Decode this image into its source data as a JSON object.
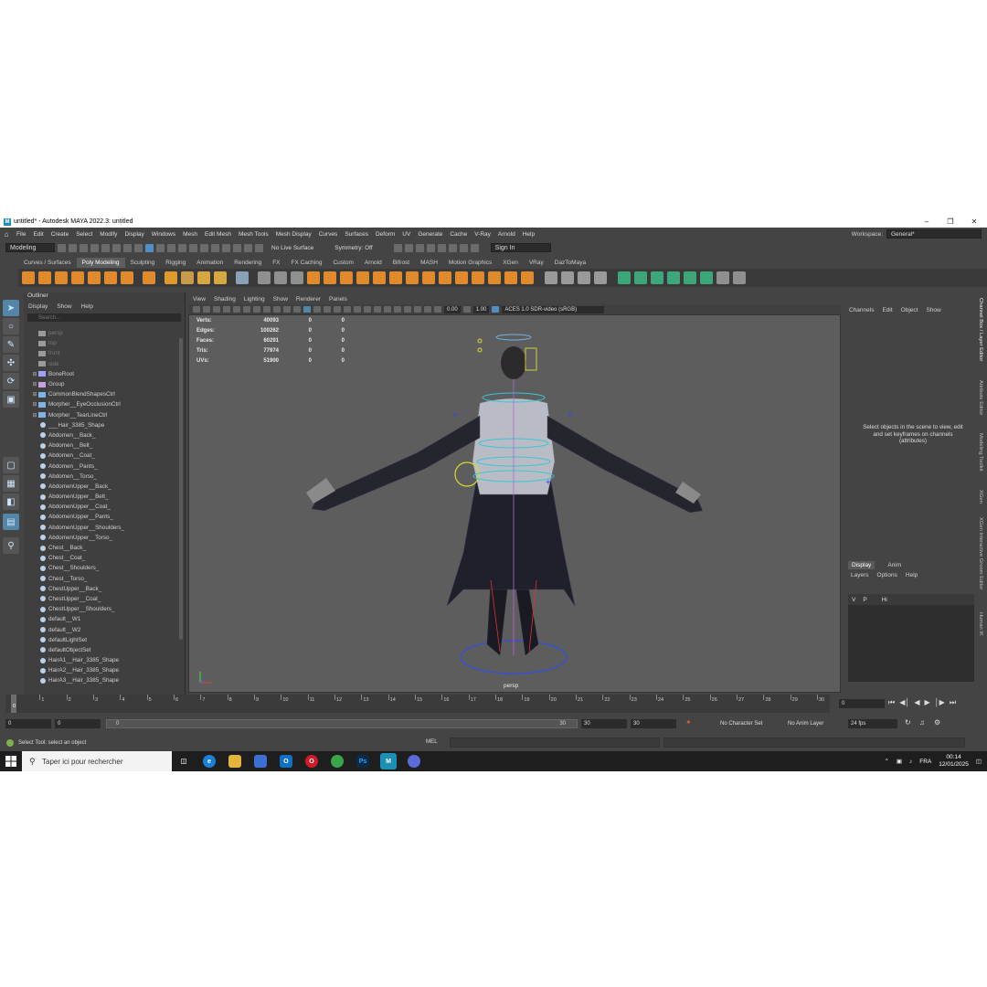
{
  "window": {
    "title": "untitled* - Autodesk MAYA 2022.3: untitled"
  },
  "menubar": {
    "items": [
      "File",
      "Edit",
      "Create",
      "Select",
      "Modify",
      "Display",
      "Windows",
      "Mesh",
      "Edit Mesh",
      "Mesh Tools",
      "Mesh Display",
      "Curves",
      "Surfaces",
      "Deform",
      "UV",
      "Generate",
      "Cache",
      "V-Ray",
      "Arnold",
      "Help"
    ]
  },
  "workspace": {
    "label": "Workspace:",
    "value": "General*"
  },
  "statusline": {
    "mode": "Modeling",
    "live_surface": "No Live Surface",
    "symmetry": "Symmetry: Off",
    "sign_in": "Sign In"
  },
  "shelf": {
    "tabs": [
      "Curves / Surfaces",
      "Poly Modeling",
      "Sculpting",
      "Rigging",
      "Animation",
      "Rendering",
      "FX",
      "FX Caching",
      "Custom",
      "Arnold",
      "Bifrost",
      "MASH",
      "Motion Graphics",
      "XGen",
      "VRay",
      "DazToMaya"
    ],
    "active_tab": "Poly Modeling"
  },
  "outliner": {
    "title": "Outliner",
    "menu": [
      "Display",
      "Show",
      "Help"
    ],
    "search_placeholder": "Search...",
    "items": [
      {
        "name": "persp",
        "kind": "camera",
        "dim": true
      },
      {
        "name": "top",
        "kind": "camera",
        "dim": true
      },
      {
        "name": "front",
        "kind": "camera",
        "dim": true
      },
      {
        "name": "side",
        "kind": "camera",
        "dim": true
      },
      {
        "name": "BoneRoot",
        "kind": "joint",
        "expand": true
      },
      {
        "name": "Group",
        "kind": "group",
        "expand": true
      },
      {
        "name": "CommonBlendShapesCtrl",
        "kind": "curve",
        "expand": true
      },
      {
        "name": "Morpher__EyeOcclusionCtrl",
        "kind": "curve",
        "expand": true
      },
      {
        "name": "Morpher__TearLineCtrl",
        "kind": "curve",
        "expand": true
      },
      {
        "name": "___Hair_3385_Shape",
        "kind": "set"
      },
      {
        "name": "Abdomen__Back_",
        "kind": "set"
      },
      {
        "name": "Abdomen__Belt_",
        "kind": "set"
      },
      {
        "name": "Abdomen__Coat_",
        "kind": "set"
      },
      {
        "name": "Abdomen__Pants_",
        "kind": "set"
      },
      {
        "name": "Abdomen__Torso_",
        "kind": "set"
      },
      {
        "name": "AbdomenUpper__Back_",
        "kind": "set"
      },
      {
        "name": "AbdomenUpper__Belt_",
        "kind": "set"
      },
      {
        "name": "AbdomenUpper__Coat_",
        "kind": "set"
      },
      {
        "name": "AbdomenUpper__Pants_",
        "kind": "set"
      },
      {
        "name": "AbdomenUpper__Shoulders_",
        "kind": "set"
      },
      {
        "name": "AbdomenUpper__Torso_",
        "kind": "set"
      },
      {
        "name": "Chest__Back_",
        "kind": "set"
      },
      {
        "name": "Chest__Coat_",
        "kind": "set"
      },
      {
        "name": "Chest__Shoulders_",
        "kind": "set"
      },
      {
        "name": "Chest__Torso_",
        "kind": "set"
      },
      {
        "name": "ChestUpper__Back_",
        "kind": "set"
      },
      {
        "name": "ChestUpper__Coat_",
        "kind": "set"
      },
      {
        "name": "ChestUpper__Shoulders_",
        "kind": "set"
      },
      {
        "name": "default__W1",
        "kind": "set"
      },
      {
        "name": "default__W2",
        "kind": "set"
      },
      {
        "name": "defaultLightSet",
        "kind": "set"
      },
      {
        "name": "defaultObjectSet",
        "kind": "set"
      },
      {
        "name": "HairA1__Hair_3385_Shape",
        "kind": "set"
      },
      {
        "name": "HairA2__Hair_3385_Shape",
        "kind": "set"
      },
      {
        "name": "HairA3__Hair_3385_Shape",
        "kind": "set"
      }
    ]
  },
  "viewport": {
    "menu": [
      "View",
      "Shading",
      "Lighting",
      "Show",
      "Renderer",
      "Panels"
    ],
    "exposure": "0.00",
    "gamma": "1.00",
    "color_space": "ACES 1.0 SDR-video (sRGB)",
    "camera": "persp",
    "hud": [
      {
        "label": "Verts:",
        "total": "40093",
        "sel": "0",
        "comp": "0"
      },
      {
        "label": "Edges:",
        "total": "100262",
        "sel": "0",
        "comp": "0"
      },
      {
        "label": "Faces:",
        "total": "60291",
        "sel": "0",
        "comp": "0"
      },
      {
        "label": "Tris:",
        "total": "77974",
        "sel": "0",
        "comp": "0"
      },
      {
        "label": "UVs:",
        "total": "51900",
        "sel": "0",
        "comp": "0"
      }
    ]
  },
  "channelbox": {
    "menu": [
      "Channels",
      "Edit",
      "Object",
      "Show"
    ],
    "message": "Select objects in the scene to view, edit and set keyframes on channels (attributes)"
  },
  "sidetabs": [
    "Channel Box / Layer Editor",
    "Attribute Editor",
    "Modeling Toolkit",
    "XGen",
    "XGen Interactive Groom Editor",
    "Human IK"
  ],
  "layers": {
    "tabs": [
      "Display",
      "Anim"
    ],
    "active_tab": "Display",
    "menu": [
      "Layers",
      "Options",
      "Help"
    ],
    "row": {
      "v": "V",
      "p": "P",
      "name": "Hi"
    }
  },
  "timeline": {
    "ticks": [
      "1",
      "2",
      "3",
      "4",
      "5",
      "6",
      "7",
      "8",
      "9",
      "10",
      "11",
      "12",
      "13",
      "14",
      "15",
      "16",
      "17",
      "18",
      "19",
      "20",
      "21",
      "22",
      "23",
      "24",
      "25",
      "26",
      "27",
      "28",
      "29",
      "30"
    ],
    "current_frame": "0",
    "frame_field": "0",
    "current_marker": "0"
  },
  "range": {
    "start": "0",
    "playback_start": "0",
    "range_start_label": "0",
    "range_end_label": "30",
    "playback_end": "30",
    "end": "30",
    "character_set": "No Character Set",
    "anim_layer": "No Anim Layer",
    "fps": "24 fps"
  },
  "helpline": {
    "text": "Select Tool: select an object",
    "mel": "MEL"
  },
  "taskbar": {
    "search": "Taper ici pour rechercher",
    "lang": "FRA",
    "time": "00:14",
    "date": "12/01/2025"
  },
  "colors": {
    "accent": "#5285a6",
    "maya_blue": "#1fb2e0",
    "viewport_bg": "#5d5d5d"
  }
}
